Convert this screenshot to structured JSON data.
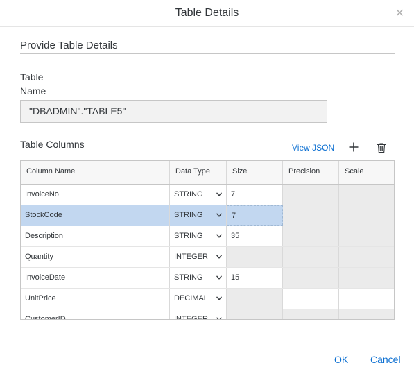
{
  "dialog": {
    "title": "Table Details",
    "close_icon": "close-icon"
  },
  "section": {
    "title": "Provide Table Details"
  },
  "table_name": {
    "label_line1": "Table",
    "label_line2": "Name",
    "value": "\"DBADMIN\".\"TABLE5\""
  },
  "columns": {
    "label": "Table Columns",
    "view_json": "View JSON",
    "add_icon": "plus-icon",
    "delete_icon": "trash-icon",
    "headers": [
      "Column Name",
      "Data Type",
      "Size",
      "Precision",
      "Scale"
    ],
    "rows": [
      {
        "name": "InvoiceNo",
        "type": "STRING",
        "size": "7",
        "size_enabled": true,
        "prec_enabled": false,
        "scale_enabled": false,
        "selected": false
      },
      {
        "name": "StockCode",
        "type": "STRING",
        "size": "7",
        "size_enabled": true,
        "prec_enabled": false,
        "scale_enabled": false,
        "selected": true
      },
      {
        "name": "Description",
        "type": "STRING",
        "size": "35",
        "size_enabled": true,
        "prec_enabled": false,
        "scale_enabled": false,
        "selected": false
      },
      {
        "name": "Quantity",
        "type": "INTEGER",
        "size": "",
        "size_enabled": false,
        "prec_enabled": false,
        "scale_enabled": false,
        "selected": false
      },
      {
        "name": "InvoiceDate",
        "type": "STRING",
        "size": "15",
        "size_enabled": true,
        "prec_enabled": false,
        "scale_enabled": false,
        "selected": false
      },
      {
        "name": "UnitPrice",
        "type": "DECIMAL",
        "size": "",
        "size_enabled": false,
        "prec_enabled": true,
        "scale_enabled": true,
        "selected": false
      },
      {
        "name": "CustomerID",
        "type": "INTEGER",
        "size": "",
        "size_enabled": false,
        "prec_enabled": false,
        "scale_enabled": false,
        "selected": false
      }
    ]
  },
  "footer": {
    "ok": "OK",
    "cancel": "Cancel"
  },
  "colors": {
    "accent": "#0a6ed1",
    "selected_row": "#c2d7f0",
    "disabled_cell": "#ebebeb"
  }
}
